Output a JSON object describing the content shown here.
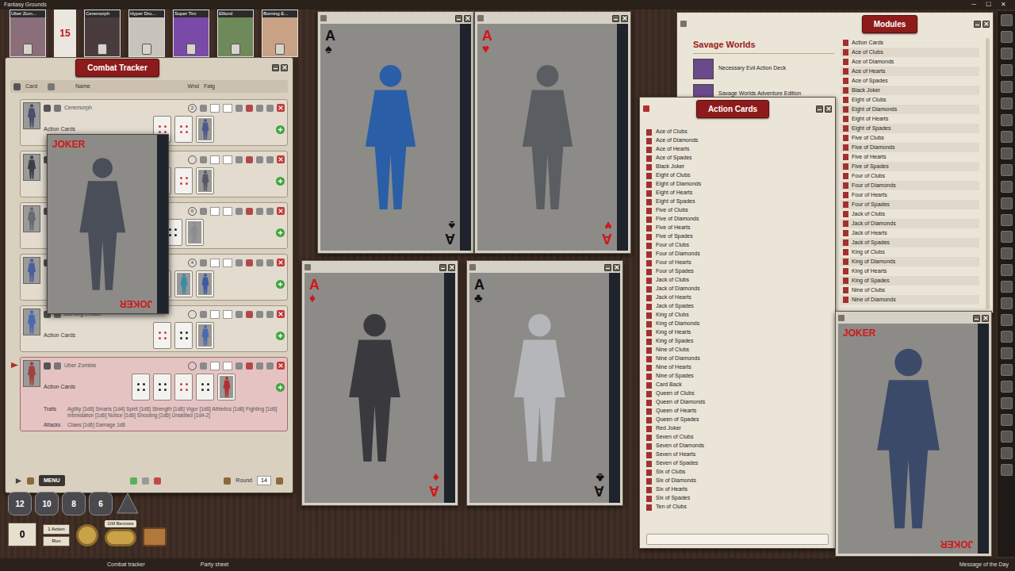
{
  "app": {
    "title": "Fantasy Grounds",
    "controls": [
      "─",
      "☐",
      "✕"
    ]
  },
  "portraits": [
    {
      "name": "Uber Zom...",
      "color": "#8a6f7a"
    },
    {
      "name": "Ceremorph",
      "color": "#4a3c3c"
    },
    {
      "name": "Hyper Dro...",
      "color": "#c8c4bc"
    },
    {
      "name": "Super Tim",
      "color": "#7a4aa8"
    },
    {
      "name": "Elltord",
      "color": "#6f8a5a"
    },
    {
      "name": "Burning E...",
      "color": "#c9a184"
    }
  ],
  "round_counter": "15",
  "combat_tracker": {
    "title": "Combat Tracker",
    "columns": [
      "Card",
      "Name",
      "Wnd",
      "Fatg"
    ],
    "rows": [
      {
        "name": "Ceremorph",
        "init": "2",
        "section": "Action Cards",
        "active": false,
        "color": "#4a4f6a",
        "hand": [
          {
            "kind": "pips",
            "color": "#d23a3a"
          },
          {
            "kind": "pips",
            "color": "#d23a3a"
          },
          {
            "kind": "face",
            "color": "#4a5a8a"
          }
        ]
      },
      {
        "active": false,
        "color": "#3e3e46",
        "hand": [
          {
            "kind": "pips",
            "color": "#222222"
          },
          {
            "kind": "pips",
            "color": "#d23a3a"
          },
          {
            "kind": "face",
            "color": "#555a66"
          }
        ]
      },
      {
        "init": "6",
        "active": false,
        "color": "#6a6a72",
        "hand": [
          {
            "kind": "pips",
            "color": "#222222"
          },
          {
            "kind": "face",
            "color": "#8a8c92"
          }
        ]
      },
      {
        "init": "4",
        "active": false,
        "color": "#4a5fa0",
        "hand": [
          {
            "kind": "pips",
            "color": "#d23a3a"
          },
          {
            "kind": "face",
            "color": "#3a8aa8"
          },
          {
            "kind": "face",
            "color": "#3a5aa8"
          }
        ]
      },
      {
        "name": "Burning Ember",
        "section": "Action Cards",
        "active": false,
        "color": "#4a6ab0",
        "hand": [
          {
            "kind": "pips",
            "color": "#d23a3a"
          },
          {
            "kind": "pips",
            "color": "#222222"
          },
          {
            "kind": "face",
            "color": "#4a6ab0"
          }
        ]
      },
      {
        "name": "Uber Zombie",
        "section": "Action Cards",
        "active": true,
        "color": "#a04040",
        "hand": [
          {
            "kind": "pips",
            "color": "#222222"
          },
          {
            "kind": "pips",
            "color": "#222222"
          },
          {
            "kind": "pips",
            "color": "#d23a3a"
          },
          {
            "kind": "pips",
            "color": "#222222"
          },
          {
            "kind": "face",
            "color": "#b03030"
          }
        ],
        "traits_label": "Traits",
        "traits": "Agility [1d6] Smarts [1d4] Spirit [1d6] Strength [1d6] Vigor [1d6] Athletics [1d6] Fighting [1d6] Intimidation [1d6] Notice [1d6] Shooting [1d6] Unskilled [1d4-2]",
        "attacks_label": "Attacks",
        "attacks": "Claws [1d6] Damage 1d6"
      }
    ],
    "menu": "MENU",
    "round_label": "Round",
    "round": "14"
  },
  "popup_card": {
    "rank": "JOKER",
    "color": "#d01818",
    "figure_color": "#4a4e58"
  },
  "cards": [
    {
      "rank": "A",
      "suit": "♠",
      "color": "#111111",
      "figure_color": "#2a5fa8"
    },
    {
      "rank": "A",
      "suit": "♥",
      "color": "#d01818",
      "figure_color": "#5a5e62"
    },
    {
      "rank": "A",
      "suit": "♦",
      "color": "#d01818",
      "figure_color": "#3a3a3e"
    },
    {
      "rank": "A",
      "suit": "♣",
      "color": "#111111",
      "figure_color": "#b4b6ba"
    }
  ],
  "modules": {
    "title": "Modules",
    "category": "Savage Worlds",
    "entries": [
      "Necessary Evil Action Deck",
      "Savage Worlds Adventure Edition"
    ],
    "list": [
      "Action Cards",
      "Ace of Clubs",
      "Ace of Diamonds",
      "Ace of Hearts",
      "Ace of Spades",
      "Black Joker",
      "Eight of Clubs",
      "Eight of Diamonds",
      "Eight of Hearts",
      "Eight of Spades",
      "Five of Clubs",
      "Five of Diamonds",
      "Five of Hearts",
      "Five of Spades",
      "Four of Clubs",
      "Four of Diamonds",
      "Four of Hearts",
      "Four of Spades",
      "Jack of Clubs",
      "Jack of Diamonds",
      "Jack of Hearts",
      "Jack of Spades",
      "King of Clubs",
      "King of Diamonds",
      "King of Hearts",
      "King of Spades",
      "Nine of Clubs",
      "Nine of Diamonds"
    ]
  },
  "action_cards": {
    "title": "Action Cards",
    "items": [
      "Ace of Clubs",
      "Ace of Diamonds",
      "Ace of Hearts",
      "Ace of Spades",
      "Black Joker",
      "Eight of Clubs",
      "Eight of Diamonds",
      "Eight of Hearts",
      "Eight of Spades",
      "Five of Clubs",
      "Five of Diamonds",
      "Five of Hearts",
      "Five of Spades",
      "Four of Clubs",
      "Four of Diamonds",
      "Four of Hearts",
      "Four of Spades",
      "Jack of Clubs",
      "Jack of Diamonds",
      "Jack of Hearts",
      "Jack of Spades",
      "King of Clubs",
      "King of Diamonds",
      "King of Hearts",
      "King of Spades",
      "Nine of Clubs",
      "Nine of Diamonds",
      "Nine of Hearts",
      "Nine of Spades",
      "Card Back",
      "Queen of Clubs",
      "Queen of Diamonds",
      "Queen of Hearts",
      "Queen of Spades",
      "Red Joker",
      "Seven of Clubs",
      "Seven of Diamonds",
      "Seven of Hearts",
      "Seven of Spades",
      "Six of Clubs",
      "Six of Diamonds",
      "Six of Hearts",
      "Six of Spades",
      "Ten of Clubs"
    ],
    "search": ""
  },
  "joker_card": {
    "rank": "JOKER",
    "color": "#d01818",
    "figure_color": "#3c4a6a"
  },
  "tools": {
    "dice": [
      "12",
      "10",
      "8",
      "6"
    ],
    "modifier": "0",
    "actions": [
      "1 Action",
      "Run"
    ],
    "gm_bennies": "GM Bennies"
  },
  "taskbar": [
    "Combat tracker",
    "Party sheet",
    "Message of the Day"
  ]
}
